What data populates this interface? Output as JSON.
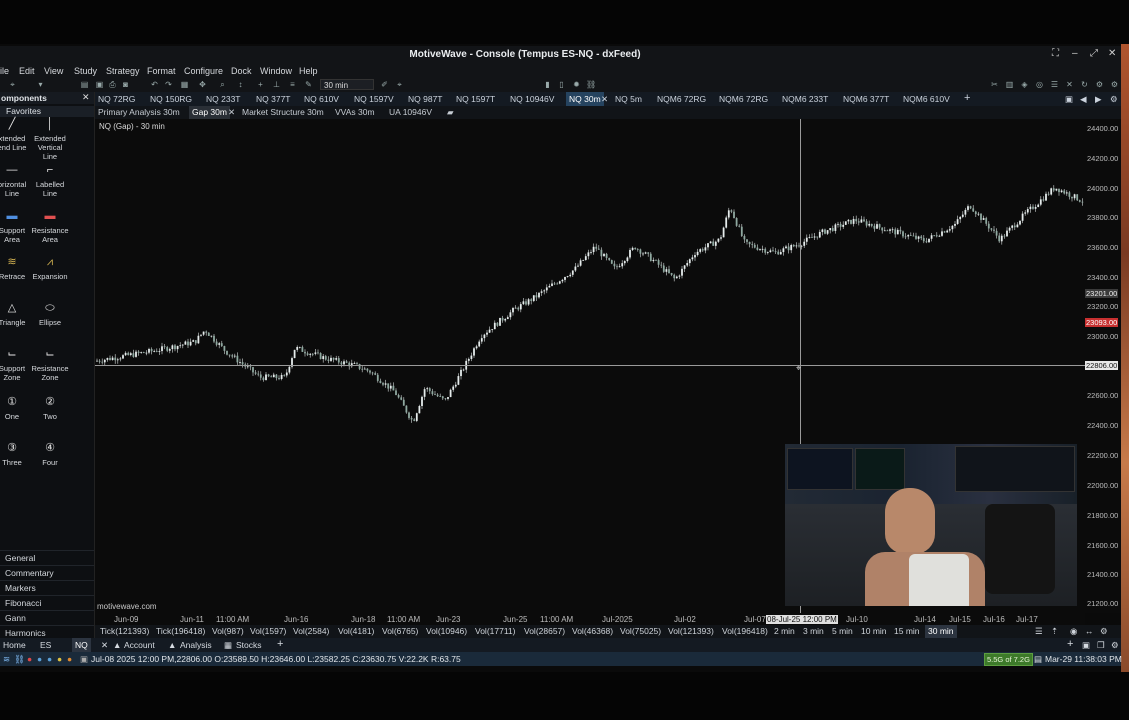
{
  "app": {
    "title": "MotiveWave - Console (Tempus ES-NQ - dxFeed)"
  },
  "menu": [
    "ile",
    "Edit",
    "View",
    "Study",
    "Strategy",
    "Format",
    "Configure",
    "Dock",
    "Window",
    "Help"
  ],
  "toolbar": {
    "timeframe": "30 min"
  },
  "chart_tabs": [
    "NQ 72RG",
    "NQ 150RG",
    "NQ 233T",
    "NQ 377T",
    "NQ 610V",
    "NQ 1597V",
    "NQ 987T",
    "NQ 1597T",
    "NQ 10946V",
    "NQ 30m",
    "NQ 5m",
    "NQM6 72RG",
    "NQM6 72RG",
    "NQM6 233T",
    "NQM6 377T",
    "NQM6 610V"
  ],
  "active_chart_tab": "NQ 30m",
  "page_tabs": [
    "Primary Analysis 30m",
    "Gap 30m",
    "Market Structure 30m",
    "VVAs 30m",
    "UA 10946V"
  ],
  "sidebar": {
    "header": "omponents",
    "favorites": "Favorites",
    "tools": [
      {
        "label": "xtended\nend Line",
        "icon": "line-icon"
      },
      {
        "label": "Extended\nVertical\nLine",
        "icon": "vertical-line-icon"
      },
      {
        "label": "orizontal\nLine",
        "icon": "horizontal-line-icon"
      },
      {
        "label": "Labelled\nLine",
        "icon": "labelled-line-icon"
      },
      {
        "label": "Support\nArea",
        "icon": "support-area-icon"
      },
      {
        "label": "Resistance\nArea",
        "icon": "resistance-area-icon"
      },
      {
        "label": "Retrace",
        "icon": "retrace-icon"
      },
      {
        "label": "Expansion",
        "icon": "expansion-icon"
      },
      {
        "label": "Triangle",
        "icon": "triangle-icon"
      },
      {
        "label": "Ellipse",
        "icon": "ellipse-icon"
      },
      {
        "label": "Support\nZone",
        "icon": "support-zone-icon"
      },
      {
        "label": "Resistance\nZone",
        "icon": "resistance-zone-icon"
      },
      {
        "label": "One",
        "icon": "circle-1-icon"
      },
      {
        "label": "Two",
        "icon": "circle-2-icon"
      },
      {
        "label": "Three",
        "icon": "circle-3-icon"
      },
      {
        "label": "Four",
        "icon": "circle-4-icon"
      }
    ],
    "categories": [
      "General",
      "Commentary",
      "Markers",
      "Fibonacci",
      "Gann",
      "Harmonics"
    ]
  },
  "chart": {
    "label": "NQ (Gap) - 30 min",
    "watermark": "motivewave.com",
    "y_ticks": [
      "24400.00",
      "24200.00",
      "24000.00",
      "23800.00",
      "23600.00",
      "23400.00",
      "23200.00",
      "23000.00",
      "22800.00",
      "22600.00",
      "22400.00",
      "22200.00",
      "22000.00",
      "21800.00",
      "21600.00",
      "21400.00",
      "21200.00"
    ],
    "price_tags": {
      "upper": "23201.00",
      "red": "23093.00",
      "crosshair": "22806.00"
    },
    "x_ticks": [
      "Jun-09",
      "Jun-11",
      "11:00 AM",
      "Jun-16",
      "Jun-18",
      "11:00 AM",
      "Jun-23",
      "Jun-25",
      "11:00 AM",
      "Jul-2025",
      "Jul-02",
      "Jul-07",
      "Jul-10",
      "Jul-14",
      "Jul-15",
      "Jul-16",
      "Jul-17"
    ],
    "crosshair_time": "08-Jul-25 12:00 PM"
  },
  "bar_types": [
    "Tick(121393)",
    "Tick(196418)",
    "Vol(987)",
    "Vol(1597)",
    "Vol(2584)",
    "Vol(4181)",
    "Vol(6765)",
    "Vol(10946)",
    "Vol(17711)",
    "Vol(28657)",
    "Vol(46368)",
    "Vol(75025)",
    "Vol(121393)",
    "Vol(196418)",
    "2 min",
    "3 min",
    "5 min",
    "10 min",
    "15 min",
    "30 min"
  ],
  "bottom_tabs": [
    "Home",
    "ES",
    "NQ",
    "Account",
    "Analysis",
    "Stocks"
  ],
  "status": {
    "ohlc": "Jul-08 2025 12:00 PM,22806.00 O:23589.50 H:23646.00 L:23582.25 C:23630.75 V:22.2K R:63.75",
    "badge": "5.5G of 7.2G",
    "clock": "Mar-29 11:38:03 PM"
  },
  "colors": {
    "accent": "#5aa0d8",
    "candle": "#dfe6e6",
    "red_tag": "#e04040"
  }
}
